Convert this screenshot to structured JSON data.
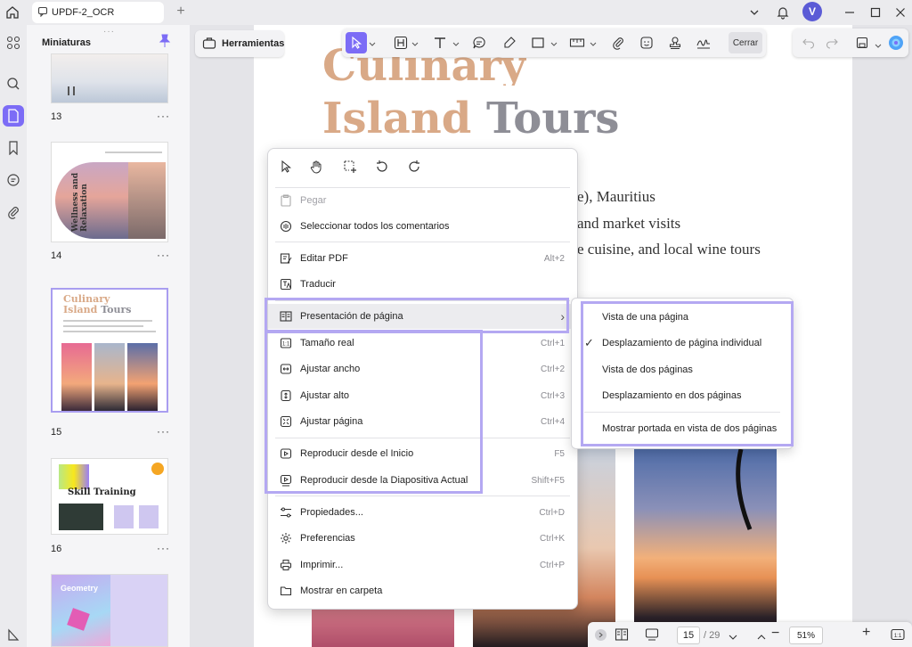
{
  "titlebar": {
    "tab_title": "UPDF-2_OCR",
    "new_tab": "+",
    "avatar_letter": "V"
  },
  "thumbnails": {
    "title": "Miniaturas",
    "more": "···",
    "pages": [
      "13",
      "14",
      "15",
      "16"
    ],
    "thumb14_text": "Wellness and Relaxation",
    "thumb15_title_a": "Culinary",
    "thumb15_title_b": "Island",
    "thumb15_title_c": "Tours",
    "thumb16_text": "Skill Training",
    "thumb17_text": "Geometry"
  },
  "toolbar": {
    "herramientas": "Herramientas",
    "cerrar": "Cerrar"
  },
  "page": {
    "title_line1": "Culinary",
    "title_line2a": "Island",
    "title_line2b": "Tours",
    "lines": [
      "e), Mauritius",
      "and market visits",
      "e cuisine, and local wine tours"
    ]
  },
  "menu": {
    "items": [
      {
        "label": "Pegar",
        "shortcut": ""
      },
      {
        "label": "Seleccionar todos los comentarios",
        "shortcut": ""
      },
      {
        "label": "Editar PDF",
        "shortcut": "Alt+2"
      },
      {
        "label": "Traducir",
        "shortcut": ""
      },
      {
        "label": "Presentación de página",
        "shortcut": ""
      },
      {
        "label": "Tamaño real",
        "shortcut": "Ctrl+1"
      },
      {
        "label": "Ajustar ancho",
        "shortcut": "Ctrl+2"
      },
      {
        "label": "Ajustar alto",
        "shortcut": "Ctrl+3"
      },
      {
        "label": "Ajustar página",
        "shortcut": "Ctrl+4"
      },
      {
        "label": "Reproducir desde el Inicio",
        "shortcut": "F5"
      },
      {
        "label": "Reproducir desde la Diapositiva Actual",
        "shortcut": "Shift+F5"
      },
      {
        "label": "Propiedades...",
        "shortcut": "Ctrl+D"
      },
      {
        "label": "Preferencias",
        "shortcut": "Ctrl+K"
      },
      {
        "label": "Imprimir...",
        "shortcut": "Ctrl+P"
      },
      {
        "label": "Mostrar en carpeta",
        "shortcut": ""
      }
    ],
    "submenu_arrow": "›"
  },
  "submenu": {
    "items": [
      "Vista de una página",
      "Desplazamiento de página individual",
      "Vista de dos páginas",
      "Desplazamiento en dos páginas",
      "Mostrar portada en vista de dos páginas"
    ],
    "checked_index": 1,
    "check": "✓"
  },
  "bottombar": {
    "current_page": "15",
    "total": "/ 29",
    "zoom": "51%",
    "minus": "−",
    "plus": "+"
  },
  "colors": {
    "accent": "#7c6cf6",
    "highlight": "#b4a8f2",
    "title_peach": "#d9a987",
    "title_gray": "#8e8e96"
  }
}
